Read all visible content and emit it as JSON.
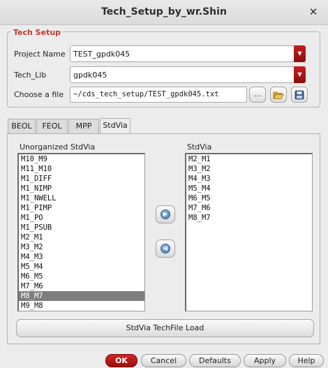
{
  "window": {
    "title": "Tech_Setup_by_wr.Shin",
    "close_glyph": "✕"
  },
  "tech_setup": {
    "group_title": "Tech Setup",
    "project_name_label": "Project Name",
    "project_name_value": "TEST_gpdk045",
    "tech_lib_label": "Tech_Lib",
    "tech_lib_value": "gpdk045",
    "choose_file_label": "Choose a file",
    "file_path": "~/cds_tech_setup/TEST_gpdk045.txt",
    "browse_label": "...",
    "open_icon": "folder-open-icon",
    "save_icon": "save-icon"
  },
  "tabs": [
    "BEOL",
    "FEOL",
    "MPP",
    "StdVia"
  ],
  "active_tab": "StdVia",
  "stdvia": {
    "left_title": "Unorganized StdVia",
    "left_items": [
      "M10_M9",
      "M11_M10",
      "M1_DIFF",
      "M1_NIMP",
      "M1_NWELL",
      "M1_PIMP",
      "M1_PO",
      "M1_PSUB",
      "M2_M1",
      "M3_M2",
      "M4_M3",
      "M5_M4",
      "M6_M5",
      "M7_M6",
      "M8_M7",
      "M9_M8"
    ],
    "left_selected": "M8_M7",
    "right_title": "StdVia",
    "right_items": [
      "M2_M1",
      "M3_M2",
      "M4_M3",
      "M5_M4",
      "M6_M5",
      "M7_M6",
      "M8_M7"
    ],
    "load_button": "StdVia TechFile Load"
  },
  "footer": {
    "ok": "OK",
    "cancel": "Cancel",
    "defaults": "Defaults",
    "apply": "Apply",
    "help": "Help"
  },
  "colors": {
    "accent": "#c0392b",
    "ok_button": "#b81818",
    "selection": "#7d7d7d"
  }
}
